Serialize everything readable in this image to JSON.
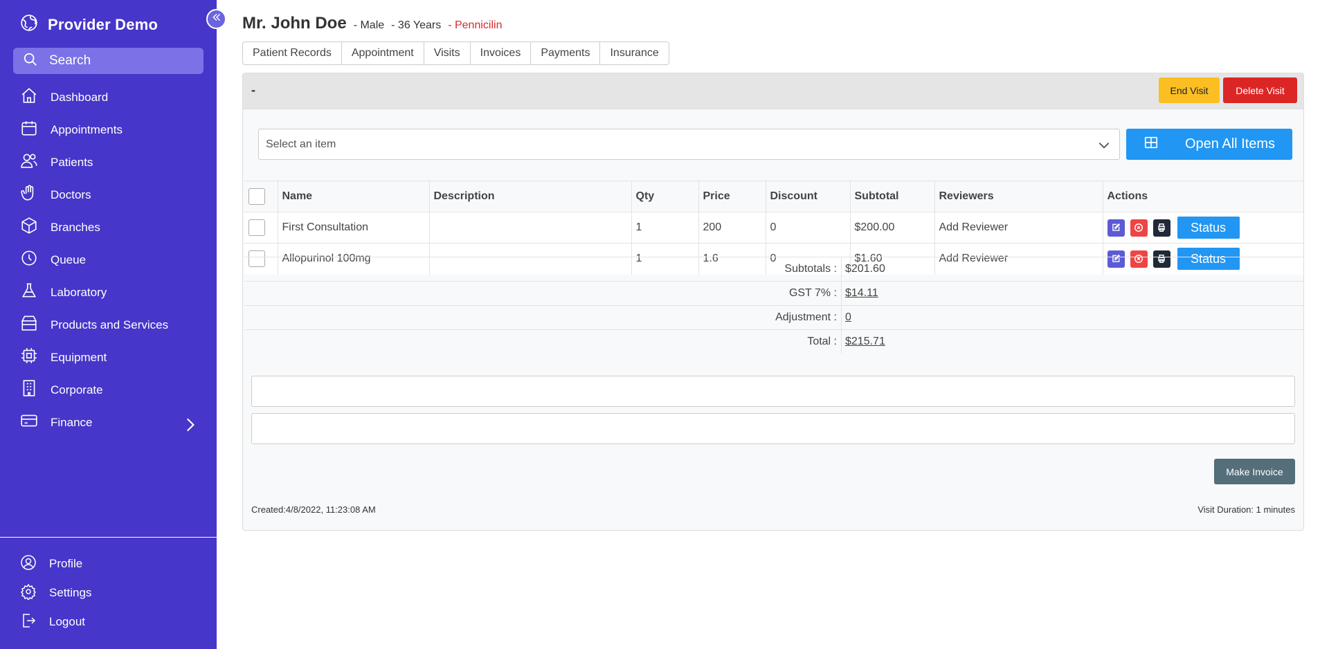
{
  "sidebar": {
    "brand": "Provider Demo",
    "search_label": "Search",
    "items": [
      {
        "label": "Dashboard",
        "icon": "home-icon"
      },
      {
        "label": "Appointments",
        "icon": "calendar-icon"
      },
      {
        "label": "Patients",
        "icon": "users-icon"
      },
      {
        "label": "Doctors",
        "icon": "hand-icon"
      },
      {
        "label": "Branches",
        "icon": "cube-icon"
      },
      {
        "label": "Queue",
        "icon": "clock-icon"
      },
      {
        "label": "Laboratory",
        "icon": "flask-icon"
      },
      {
        "label": "Products and Services",
        "icon": "box-icon"
      },
      {
        "label": "Equipment",
        "icon": "chip-icon"
      },
      {
        "label": "Corporate",
        "icon": "building-icon"
      },
      {
        "label": "Finance",
        "icon": "card-icon"
      }
    ],
    "bottom_items": [
      {
        "label": "Profile",
        "icon": "user-circle-icon"
      },
      {
        "label": "Settings",
        "icon": "gear-icon"
      },
      {
        "label": "Logout",
        "icon": "logout-icon"
      }
    ]
  },
  "patient": {
    "name": "Mr. John Doe",
    "gender": "- Male",
    "age": "- 36 Years",
    "allergy": "- Pennicilin"
  },
  "tabs": [
    "Patient Records",
    "Appointment",
    "Visits",
    "Invoices",
    "Payments",
    "Insurance"
  ],
  "visit": {
    "title": "-",
    "end_label": "End Visit",
    "delete_label": "Delete Visit",
    "select_placeholder": "Select an item",
    "open_all_label": "Open All Items",
    "columns": [
      "Name",
      "Description",
      "Qty",
      "Price",
      "Discount",
      "Subtotal",
      "Reviewers",
      "Actions"
    ],
    "rows": [
      {
        "name": "First Consultation",
        "description": "",
        "qty": "1",
        "price": "200",
        "discount": "0",
        "subtotal": "$200.00",
        "reviewer": "Add Reviewer",
        "status": "Status"
      },
      {
        "name": "Allopurinol 100mg",
        "description": "",
        "qty": "1",
        "price": "1.6",
        "discount": "0",
        "subtotal": "$1.60",
        "reviewer": "Add Reviewer",
        "status": "Status"
      }
    ],
    "totals": [
      {
        "label": "Subtotals :",
        "value": "$201.60",
        "link": false
      },
      {
        "label": "GST 7% :",
        "value": "$14.11",
        "link": true
      },
      {
        "label": "Adjustment :",
        "value": "0",
        "link": true
      },
      {
        "label": "Total :",
        "value": "$215.71",
        "link": true
      }
    ],
    "make_invoice_label": "Make Invoice",
    "created": "Created:4/8/2022, 11:23:08 AM",
    "duration": "Visit Duration: 1 minutes"
  }
}
